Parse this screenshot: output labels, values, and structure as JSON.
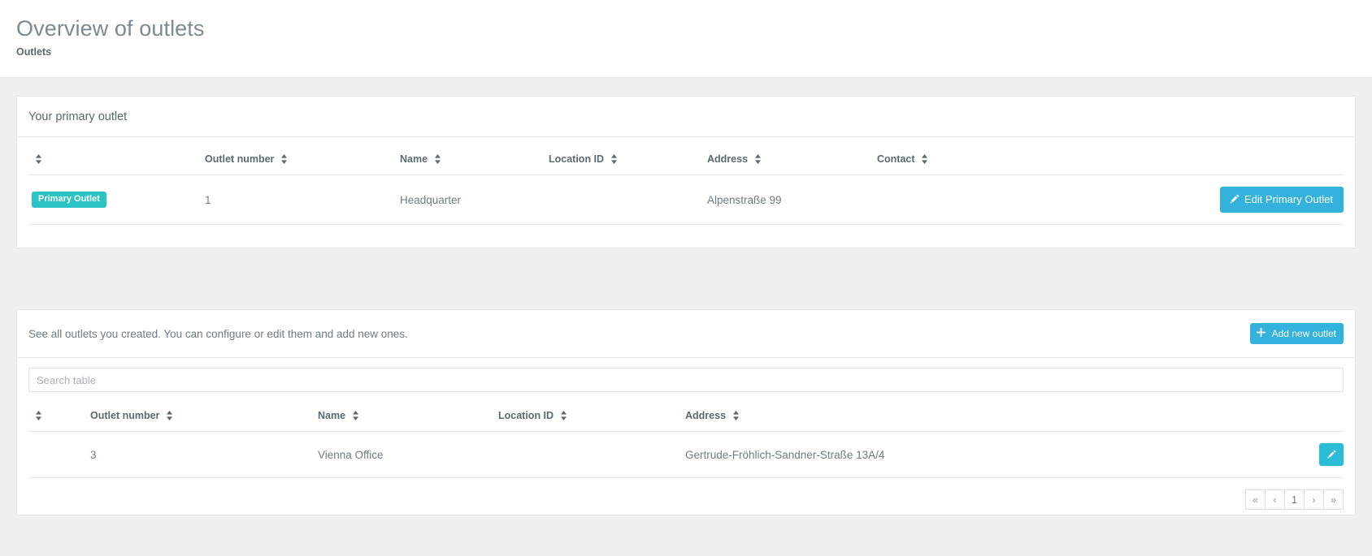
{
  "header": {
    "title": "Overview of outlets",
    "breadcrumb": "Outlets"
  },
  "primary_card": {
    "header_title": "Your primary outlet",
    "columns": [
      "",
      "Outlet number",
      "Name",
      "Location ID",
      "Address",
      "Contact",
      ""
    ],
    "row": {
      "badge": "Primary Outlet",
      "outlet_number": "1",
      "name": "Headquarter",
      "location_id": "",
      "address": "Alpenstraße 99",
      "contact": ""
    },
    "edit_button_label": "Edit Primary Outlet",
    "edit_button_icon": "pencil-icon"
  },
  "outlets_card": {
    "intro_text": "See all outlets you created. You can configure or edit them and add new ones.",
    "add_button_label": "Add new outlet",
    "add_button_icon": "plus-icon",
    "search_placeholder": "Search table",
    "search_value": "",
    "columns": [
      "",
      "Outlet number",
      "Name",
      "Location ID",
      "Address",
      ""
    ],
    "rows": [
      {
        "outlet_number": "3",
        "name": "Vienna Office",
        "location_id": "",
        "address": "Gertrude-Fröhlich-Sandner-Straße 13A/4",
        "edit_icon": "pencil-icon"
      }
    ],
    "pagination": {
      "first": "«",
      "prev": "‹",
      "pages": [
        "1"
      ],
      "next": "›",
      "last": "»"
    }
  },
  "colors": {
    "accent_blue": "#32b2dd",
    "badge_teal": "#2bc4c4",
    "text_muted": "#6e7c85",
    "page_bg": "#f0f0f0"
  }
}
